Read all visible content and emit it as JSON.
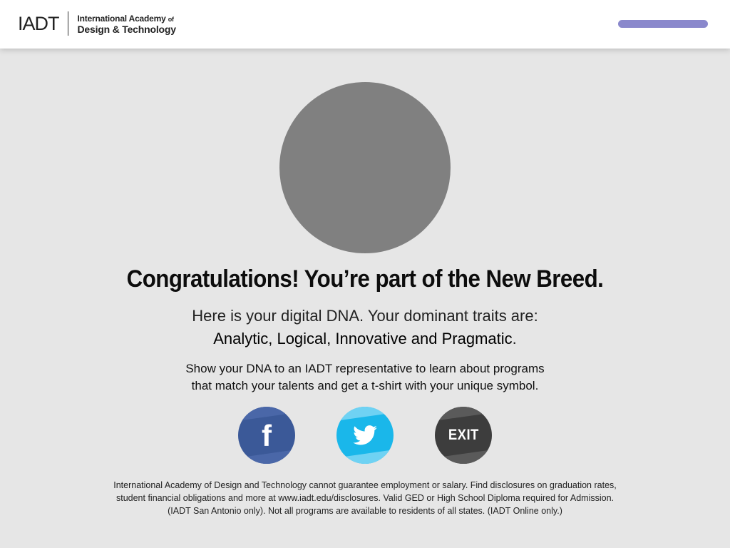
{
  "header": {
    "logo_mark": "IADT",
    "logo_line1": "International Academy",
    "logo_line1_of": "of",
    "logo_line2": "Design & Technology",
    "progress_color": "#8a88cc"
  },
  "result": {
    "avatar_color": "#808080",
    "headline": "Congratulations! You’re part of the New Breed.",
    "traits_intro": "Here is your digital DNA. Your dominant traits are:",
    "traits": "Analytic, Logical, Innovative and Pragmatic",
    "traits_end": ".",
    "instructions_line1": "Show your DNA to an IADT representative to learn about programs",
    "instructions_line2": "that match your talents and get a t-shirt with your unique symbol."
  },
  "actions": {
    "facebook_icon": "facebook-icon",
    "facebook_glyph": "f",
    "facebook_color": "#3b5998",
    "twitter_icon": "twitter-bird-icon",
    "twitter_color": "#1ab7ea",
    "exit_label": "EXIT",
    "exit_color": "#3d3d3d"
  },
  "footer": {
    "disclaimer_line1": "International Academy of Design and Technology cannot guarantee employment or salary. Find disclosures on graduation rates,",
    "disclaimer_line2": "student financial obligations and more at www.iadt.edu/disclosures. Valid GED or High School Diploma required for Admission.",
    "disclaimer_line3": "(IADT San Antonio only). Not all programs are available to residents of all states. (IADT Online only.)"
  }
}
